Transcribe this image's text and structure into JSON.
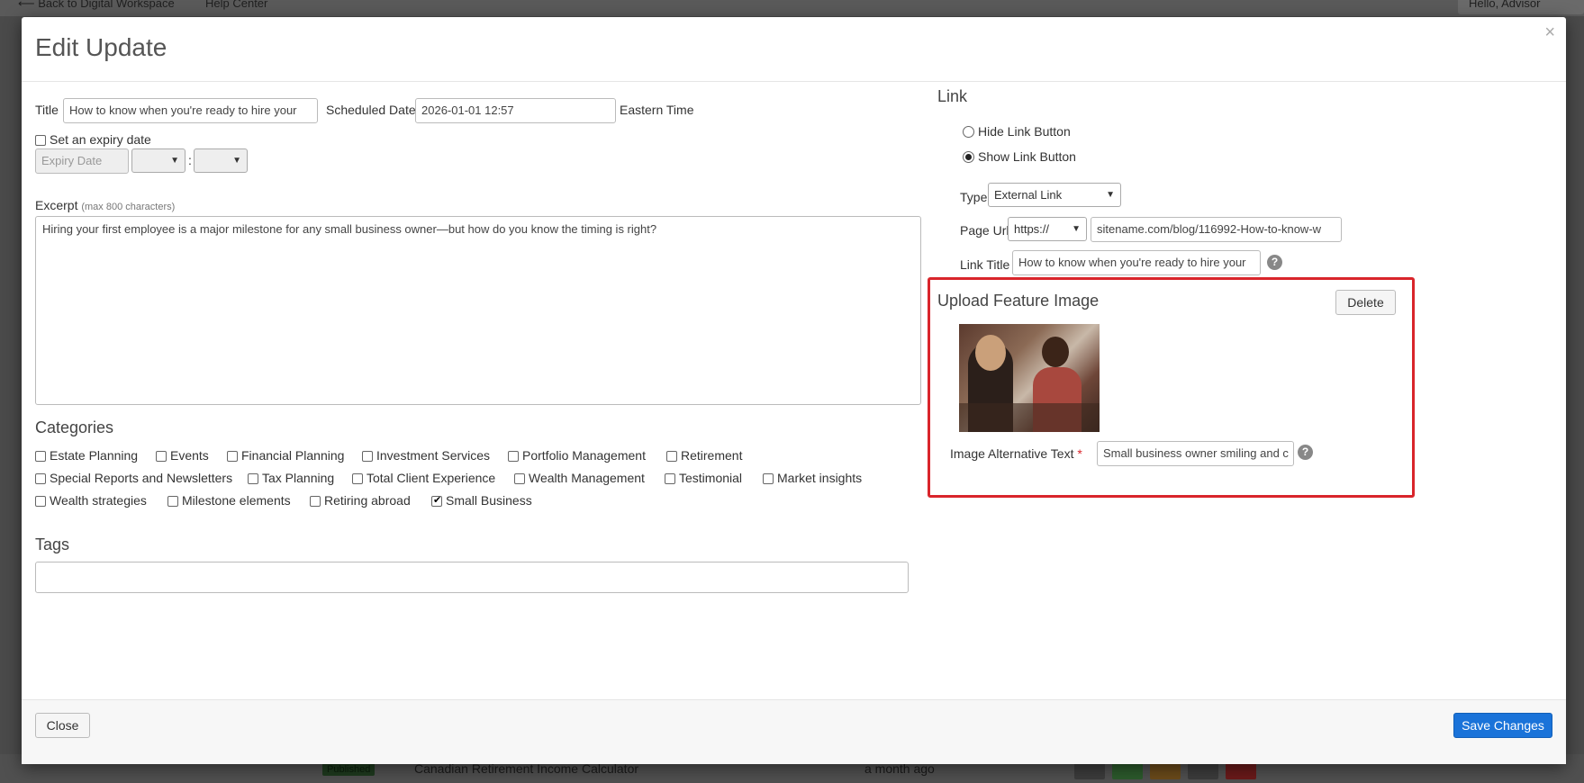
{
  "background": {
    "back_link": "⟵ Back to Digital Workspace",
    "help_center": "Help Center",
    "user_greeting": "Hello, Advisor",
    "row_status": "Published",
    "row_title": "Canadian Retirement Income Calculator",
    "row_time": "a month ago"
  },
  "modal": {
    "title": "Edit Update",
    "close_icon": "×"
  },
  "form": {
    "title_label": "Title",
    "title_value": "How to know when you're ready to hire your",
    "scheduled_label": "Scheduled Date",
    "scheduled_value": "2026-01-01 12:57",
    "timezone": "Eastern Time",
    "expiry_checkbox_label": "Set an expiry date",
    "expiry_placeholder": "Expiry Date",
    "time_separator": ":",
    "excerpt_label": "Excerpt",
    "excerpt_hint": "(max 800 characters)",
    "excerpt_value": "Hiring your first employee is a major milestone for any small business owner—but how do you know the timing is right?",
    "categories_heading": "Categories",
    "categories": [
      {
        "label": "Estate Planning",
        "checked": false
      },
      {
        "label": "Events",
        "checked": false
      },
      {
        "label": "Financial Planning",
        "checked": false
      },
      {
        "label": "Investment Services",
        "checked": false
      },
      {
        "label": "Portfolio Management",
        "checked": false
      },
      {
        "label": "Retirement",
        "checked": false
      },
      {
        "label": "Special Reports and Newsletters",
        "checked": false
      },
      {
        "label": "Tax Planning",
        "checked": false
      },
      {
        "label": "Total Client Experience",
        "checked": false
      },
      {
        "label": "Wealth Management",
        "checked": false
      },
      {
        "label": "Testimonial",
        "checked": false
      },
      {
        "label": "Market insights",
        "checked": false
      },
      {
        "label": "Wealth strategies",
        "checked": false
      },
      {
        "label": "Milestone elements",
        "checked": false
      },
      {
        "label": "Retiring abroad",
        "checked": false
      },
      {
        "label": "Small Business",
        "checked": true
      }
    ],
    "tags_heading": "Tags",
    "tags_value": ""
  },
  "link": {
    "heading": "Link",
    "hide_label": "Hide Link Button",
    "show_label": "Show Link Button",
    "selected": "show",
    "type_label": "Type",
    "type_value": "External Link",
    "page_url_label": "Page Url",
    "protocol_value": "https://",
    "url_value": "sitename.com/blog/116992-How-to-know-w",
    "link_title_label": "Link Title",
    "link_title_value": "How to know when you're ready to hire your",
    "help_icon": "?"
  },
  "feature_image": {
    "heading": "Upload Feature Image",
    "delete_label": "Delete",
    "alt_label": "Image Alternative Text",
    "required_mark": "*",
    "alt_value": "Small business owner smiling and c",
    "help_icon": "?"
  },
  "footer": {
    "close_label": "Close",
    "save_label": "Save Changes"
  },
  "colors": {
    "primary": "#1a73d9",
    "highlight": "#d9252b",
    "overlay": "#4a4a4a"
  }
}
